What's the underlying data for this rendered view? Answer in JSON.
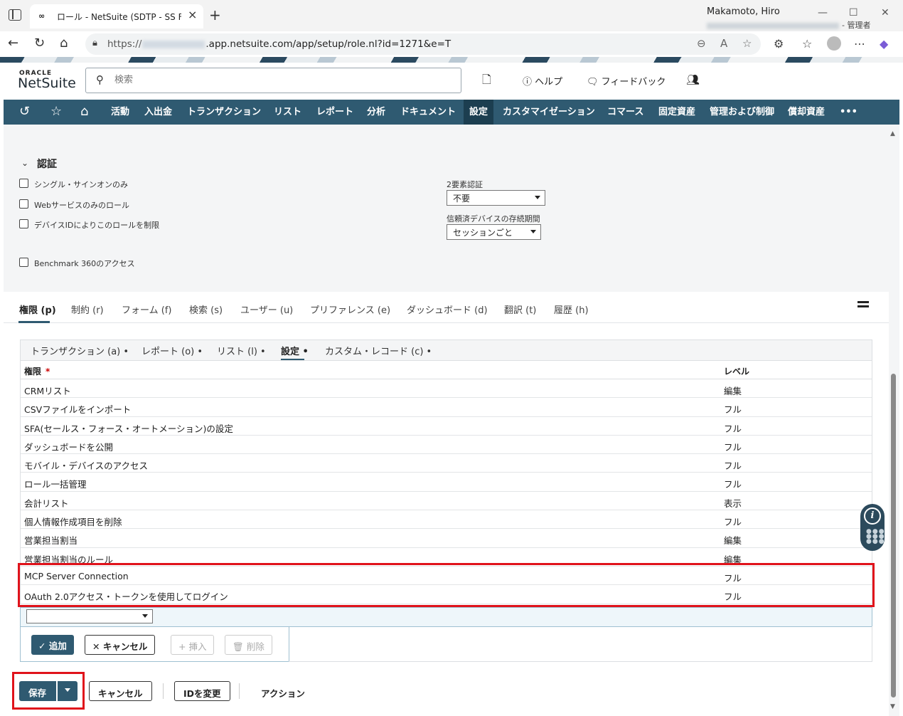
{
  "browser": {
    "tab_title": "ロール - NetSuite (SDTP - SS FF Pre",
    "url_prefix": "https://",
    "url_suffix": ".app.netsuite.com/app/setup/role.nl?id=1271&e=T"
  },
  "header": {
    "logo_top": "ORACLE",
    "logo_main": "NetSuite",
    "search_placeholder": "検索",
    "help": "ヘルプ",
    "feedback": "フィードバック",
    "user_name": "Makamoto, Hiro",
    "user_role": "- 管理者"
  },
  "nav": {
    "items": [
      "活動",
      "入出金",
      "トランザクション",
      "リスト",
      "レポート",
      "分析",
      "ドキュメント",
      "設定",
      "カスタマイゼーション",
      "コマース",
      "固定資産",
      "管理および制御",
      "償却資産"
    ],
    "more": "•••"
  },
  "auth": {
    "title": "認証",
    "sso_only": "シングル・サインオンのみ",
    "ws_only": "Webサービスのみのロール",
    "device_id": "デバイスIDによりこのロールを制限",
    "benchmark": "Benchmark 360のアクセス",
    "twofa_label": "2要素認証",
    "twofa_value": "不要",
    "trusted_label": "信頼済デバイスの存続期間",
    "trusted_value": "セッションごと"
  },
  "main_tabs": [
    "権限 (p)",
    "制約 (r)",
    "フォーム (f)",
    "検索 (s)",
    "ユーザー (u)",
    "プリファレンス (e)",
    "ダッシュボード (d)",
    "翻訳 (t)",
    "履歴 (h)"
  ],
  "sub_tabs": [
    "トランザクション (a) •",
    "レポート (o) •",
    "リスト (l) •",
    "設定 •",
    "カスタム・レコード (c) •"
  ],
  "grid": {
    "col_permission": "権限",
    "required_mark": "*",
    "col_level": "レベル",
    "rows": [
      {
        "permission": "CRMリスト",
        "level": "編集"
      },
      {
        "permission": "CSVファイルをインポート",
        "level": "フル"
      },
      {
        "permission": "SFA(セールス・フォース・オートメーション)の設定",
        "level": "フル"
      },
      {
        "permission": "ダッシュボードを公開",
        "level": "フル"
      },
      {
        "permission": "モバイル・デバイスのアクセス",
        "level": "フル"
      },
      {
        "permission": "ロール一括管理",
        "level": "フル"
      },
      {
        "permission": "会計リスト",
        "level": "表示"
      },
      {
        "permission": "個人情報作成項目を削除",
        "level": "フル"
      },
      {
        "permission": "営業担当割当",
        "level": "編集"
      },
      {
        "permission": "営業担当割当のルール",
        "level": "編集"
      },
      {
        "permission": "MCP Server Connection",
        "level": "フル"
      },
      {
        "permission": "OAuth 2.0アクセス・トークンを使用してログイン",
        "level": "フル"
      }
    ],
    "btn_add": "追加",
    "btn_cancel": "キャンセル",
    "btn_insert": "挿入",
    "btn_delete": "削除"
  },
  "footer": {
    "save": "保存",
    "cancel": "キャンセル",
    "change_id": "IDを変更",
    "actions": "アクション"
  },
  "colors": {
    "nav_bg": "#2f5a71",
    "highlight_red": "#e0131b"
  }
}
